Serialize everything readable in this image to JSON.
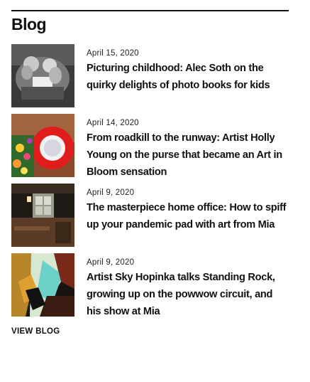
{
  "blog": {
    "heading": "Blog",
    "posts": [
      {
        "date": "April 15, 2020",
        "title": "Picturing childhood: Alec Soth on the quirky delights of photo books for kids"
      },
      {
        "date": "April 14, 2020",
        "title": "From roadkill to the runway: Artist Holly Young on the purse that became an Art in Bloom sensation"
      },
      {
        "date": "April 9, 2020",
        "title": "The masterpiece home office: How to spiff up your pandemic pad with art from Mia"
      },
      {
        "date": "April 9, 2020",
        "title": "Artist Sky Hopinka talks Standing Rock, growing up on the powwow circuit, and his show at Mia"
      }
    ],
    "view_blog_label": "VIEW BLOG"
  }
}
